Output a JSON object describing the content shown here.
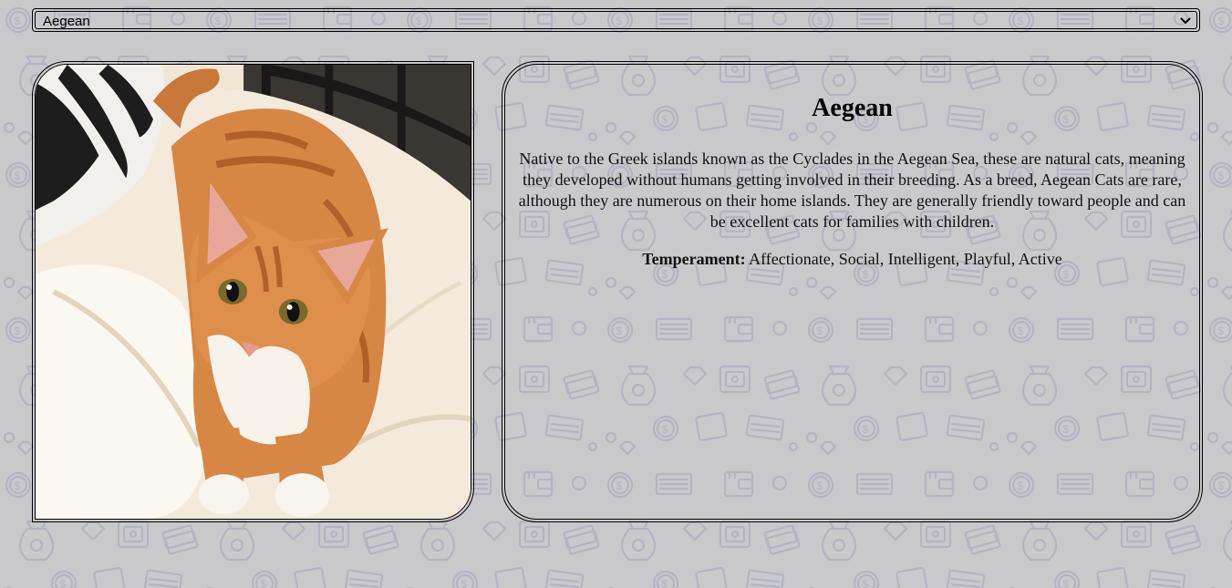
{
  "breed_selector": {
    "selected": "Aegean",
    "icon": "chevron-down-icon"
  },
  "breed": {
    "name": "Aegean",
    "description": "Native to the Greek islands known as the Cyclades in the Aegean Sea, these are natural cats, meaning they developed without humans getting involved in their breeding. As a breed, Aegean Cats are rare, although they are numerous on their home islands. They are generally friendly toward people and can be excellent cats for families with children.",
    "temperament_label": "Temperament:",
    "temperament_value": "Affectionate, Social, Intelligent, Playful, Active"
  },
  "background": {
    "color": "#c9c9cc",
    "pattern_color": "#b4b4c0",
    "pattern_icons": [
      "money-bag-icon",
      "wallet-icon",
      "coin-icon",
      "banknote-icon",
      "diamond-icon",
      "safe-icon"
    ]
  }
}
